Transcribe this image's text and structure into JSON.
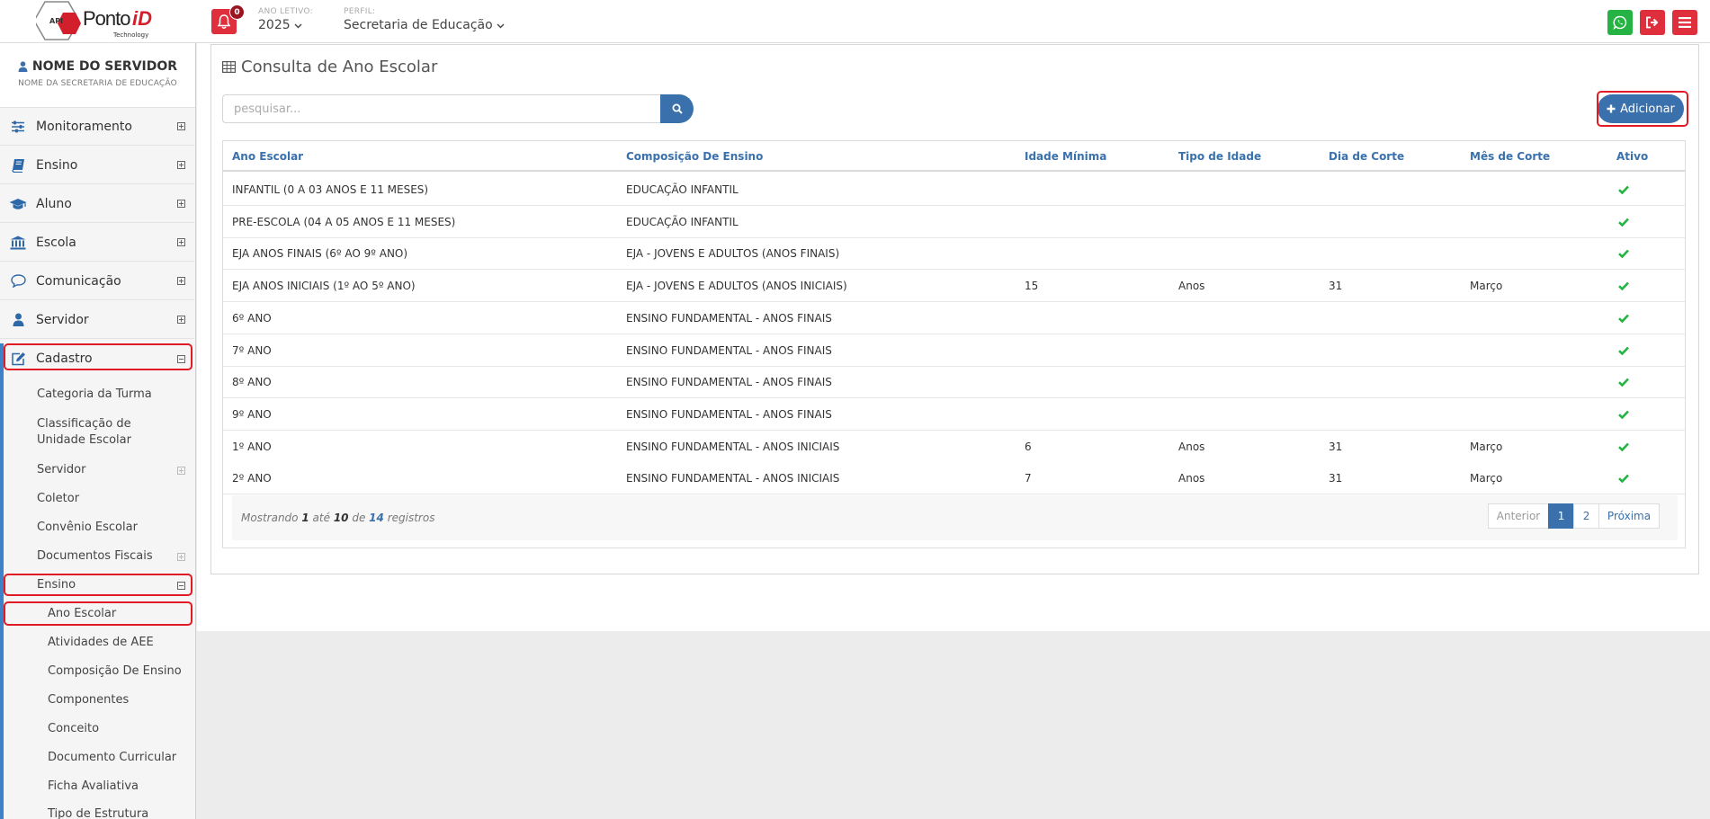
{
  "brand": {
    "logo_text": "Ponto",
    "logo_accent": "iD",
    "logo_sub": "Technology",
    "logo_badge": "API",
    "primary": "#3a71ac",
    "danger": "#e02f3c",
    "success": "#25b444"
  },
  "header": {
    "notifications_count": "0",
    "year_label": "ANO LETIVO:",
    "year_value": "2025",
    "profile_label": "PERFIL:",
    "profile_value": "Secretaria de Educação"
  },
  "sidebar": {
    "user_name": "NOME DO SERVIDOR",
    "user_sub": "NOME DA SECRETARIA DE EDUCAÇÃO",
    "menu": [
      {
        "label": "Monitoramento",
        "icon": "sliders-icon"
      },
      {
        "label": "Ensino",
        "icon": "book-icon"
      },
      {
        "label": "Aluno",
        "icon": "graduation-cap-icon"
      },
      {
        "label": "Escola",
        "icon": "bank-icon"
      },
      {
        "label": "Comunicação",
        "icon": "comment-icon"
      },
      {
        "label": "Servidor",
        "icon": "user-icon"
      },
      {
        "label": "Cadastro",
        "icon": "edit-icon"
      }
    ],
    "cadastro_items": [
      "Categoria da Turma",
      "Classificação de Unidade Escolar",
      "Servidor",
      "Coletor",
      "Convênio Escolar",
      "Documentos Fiscais",
      "Ensino"
    ],
    "ensino_items": [
      "Ano Escolar",
      "Atividades de AEE",
      "Composição De Ensino",
      "Componentes",
      "Conceito",
      "Documento Curricular",
      "Ficha Avaliativa",
      "Tipo de Estrutura"
    ]
  },
  "page": {
    "title": "Consulta de Ano Escolar",
    "search_placeholder": "pesquisar...",
    "add_label": "Adicionar"
  },
  "table": {
    "headers": [
      "Ano Escolar",
      "Composição De Ensino",
      "Idade Mínima",
      "Tipo de Idade",
      "Dia de Corte",
      "Mês de Corte",
      "Ativo"
    ],
    "rows": [
      [
        "INFANTIL (0 A 03 ANOS E 11 MESES)",
        "EDUCAÇÃO INFANTIL",
        "",
        "",
        "",
        "",
        true
      ],
      [
        "PRE-ESCOLA (04 A 05 ANOS E 11 MESES)",
        "EDUCAÇÃO INFANTIL",
        "",
        "",
        "",
        "",
        true
      ],
      [
        "EJA ANOS FINAIS (6º AO 9º ANO)",
        "EJA - JOVENS E ADULTOS (ANOS FINAIS)",
        "",
        "",
        "",
        "",
        true
      ],
      [
        "EJA ANOS INICIAIS (1º AO 5º ANO)",
        "EJA - JOVENS E ADULTOS (ANOS INICIAIS)",
        "15",
        "Anos",
        "31",
        "Março",
        true
      ],
      [
        "6º ANO",
        "ENSINO FUNDAMENTAL - ANOS FINAIS",
        "",
        "",
        "",
        "",
        true
      ],
      [
        "7º ANO",
        "ENSINO FUNDAMENTAL - ANOS FINAIS",
        "",
        "",
        "",
        "",
        true
      ],
      [
        "8º ANO",
        "ENSINO FUNDAMENTAL - ANOS FINAIS",
        "",
        "",
        "",
        "",
        true
      ],
      [
        "9º ANO",
        "ENSINO FUNDAMENTAL - ANOS FINAIS",
        "",
        "",
        "",
        "",
        true
      ],
      [
        "1º ANO",
        "ENSINO FUNDAMENTAL - ANOS INICIAIS",
        "6",
        "Anos",
        "31",
        "Março",
        true
      ],
      [
        "2º ANO",
        "ENSINO FUNDAMENTAL - ANOS INICIAIS",
        "7",
        "Anos",
        "31",
        "Março",
        true
      ]
    ],
    "info": {
      "prefix": "Mostrando",
      "from": "1",
      "mid": "até",
      "to": "10",
      "of": "de",
      "total": "14",
      "suffix": "registros"
    },
    "pagination": {
      "prev": "Anterior",
      "pages": [
        "1",
        "2"
      ],
      "active": "1",
      "next": "Próxima"
    }
  }
}
